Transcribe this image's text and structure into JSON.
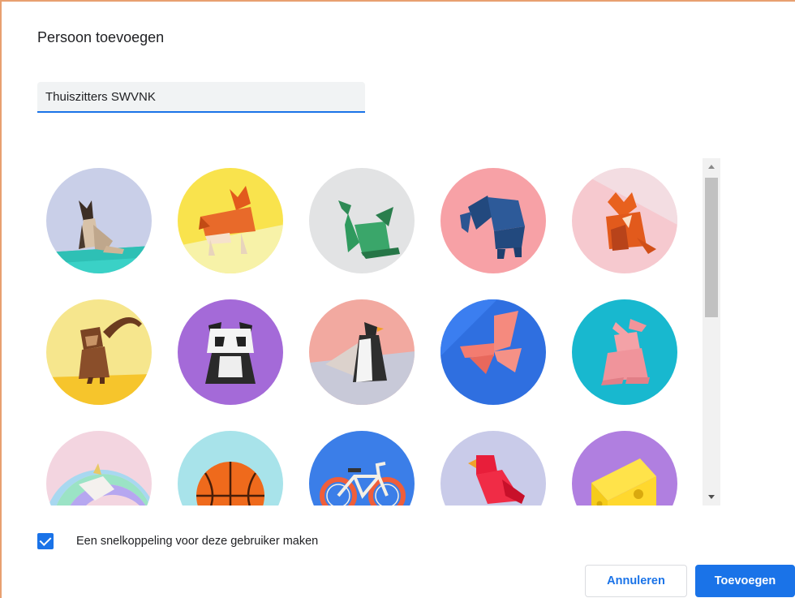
{
  "dialog": {
    "title": "Persoon toevoegen",
    "name_value": "Thuiszitters SWVNK"
  },
  "avatars": [
    {
      "name": "cat-avatar",
      "bg": "#c9cfe8"
    },
    {
      "name": "corgi-avatar",
      "bg": "#f9e34d"
    },
    {
      "name": "dragon-avatar",
      "bg": "#e2e3e4"
    },
    {
      "name": "elephant-avatar",
      "bg": "#f7a1a6"
    },
    {
      "name": "fox-avatar",
      "bg": "#f6c9cf"
    },
    {
      "name": "monkey-avatar",
      "bg": "#f6e68d"
    },
    {
      "name": "panda-avatar",
      "bg": "#a46ad8"
    },
    {
      "name": "penguin-avatar",
      "bg": "#f2a9a0"
    },
    {
      "name": "butterfly-avatar",
      "bg": "#2f6fe0"
    },
    {
      "name": "rabbit-avatar",
      "bg": "#18b8cf"
    },
    {
      "name": "unicorn-avatar",
      "bg": "#f3d5e0"
    },
    {
      "name": "basketball-avatar",
      "bg": "#a8e3ea"
    },
    {
      "name": "bicycle-avatar",
      "bg": "#3b7ee8"
    },
    {
      "name": "bird-avatar",
      "bg": "#c9cbe9"
    },
    {
      "name": "cheese-avatar",
      "bg": "#b07fe0"
    }
  ],
  "options": {
    "shortcut_label": "Een snelkoppeling voor deze gebruiker maken",
    "shortcut_checked": true
  },
  "buttons": {
    "cancel_label": "Annuleren",
    "add_label": "Toevoegen"
  },
  "colors": {
    "accent": "#1a73e8",
    "frame": "#e8a070"
  }
}
